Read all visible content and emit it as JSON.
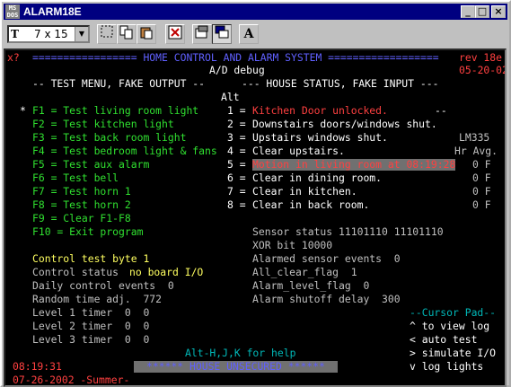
{
  "window": {
    "title": "ALARM18E",
    "icon_text": "MS\nDOS",
    "min_glyph": "_",
    "max_glyph": "□",
    "close_glyph": "×"
  },
  "toolbar": {
    "font_label": "7 x 15",
    "tt_glyph": "T",
    "font_button": "A"
  },
  "header": {
    "x_prompt": "x?",
    "title_line": "================= HOME CONTROL AND ALARM SYSTEM ==================",
    "rev": "rev 18e",
    "subtitle": "A/D debug",
    "date": "05-20-02"
  },
  "test_menu": {
    "heading": "-- TEST MENU, FAKE OUTPUT --",
    "marker": "*",
    "items": [
      "F1 = Test living room light",
      "F2 = Test kitchen light",
      "F3 = Test back room light",
      "F4 = Test bedroom light & fans",
      "F5 = Test aux alarm",
      "F6 = Test bell",
      "F7 = Test horn 1",
      "F8 = Test horn 2",
      "F9 = Clear F1-F8",
      "F10 = Exit program"
    ]
  },
  "house_status": {
    "heading": "--- HOUSE STATUS, FAKE INPUT ---",
    "alt_label": "Alt",
    "dashes": "--",
    "sensor_label": "LM335",
    "hr_avg": "Hr Avg.",
    "rows": [
      {
        "num": "1 =",
        "text": "Kitchen Door unlocked.",
        "temp": ""
      },
      {
        "num": "2 =",
        "text": "Downstairs doors/windows shut.",
        "temp": ""
      },
      {
        "num": "3 =",
        "text": "Upstairs windows shut.",
        "temp": ""
      },
      {
        "num": "4 =",
        "text": "Clear upstairs.",
        "temp": ""
      },
      {
        "num": "5 =",
        "text": "Motion in living room at 08:19:28",
        "temp": "0 F"
      },
      {
        "num": "6 =",
        "text": "Clear in dining room.",
        "temp": "0 F"
      },
      {
        "num": "7 =",
        "text": "Clear in kitchen.",
        "temp": "0 F"
      },
      {
        "num": "8 =",
        "text": "Clear in back room.",
        "temp": "0 F"
      }
    ]
  },
  "status": {
    "sensor_status": "Sensor status 11101110 11101110",
    "xor_bit": "XOR bit 10000",
    "control_test_byte": "Control test byte 1",
    "alarmed_sensor_events": "Alarmed sensor events  0",
    "control_status_label": "Control status",
    "control_status_value": "no board I/O",
    "all_clear_flag": "All_clear_flag  1",
    "daily_control_events": "Daily control events  0",
    "alarm_level_flag": "Alarm_level_flag  0",
    "random_time_adj": "Random time adj.  772",
    "alarm_shutoff_delay": "Alarm shutoff delay  300",
    "level1": "Level 1 timer  0  0",
    "level2": "Level 2 timer  0  0",
    "level3": "Level 3 timer  0  0"
  },
  "cursor_pad": {
    "title": "--Cursor Pad--",
    "items": [
      "^ to view log",
      "< auto test",
      "> simulate I/O",
      "v log lights"
    ]
  },
  "footer": {
    "help": "Alt-H,J,K for help",
    "time": "08:19:31",
    "banner": "****** HOUSE UNSECURED ******",
    "date_season": "07-26-2002 -Summer-"
  }
}
